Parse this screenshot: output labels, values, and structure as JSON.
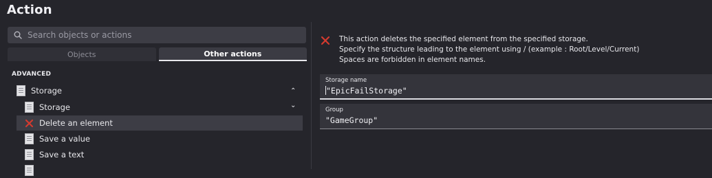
{
  "header": {
    "title": "Action"
  },
  "search": {
    "placeholder": "Search objects or actions",
    "value": ""
  },
  "tabs": [
    {
      "label": "Objects",
      "active": false
    },
    {
      "label": "Other actions",
      "active": true
    }
  ],
  "tree": {
    "section_label": "ADVANCED",
    "items": [
      {
        "label": "Storage",
        "icon": "storage-icon",
        "chevron": "up"
      },
      {
        "label": "Storage",
        "icon": "storage-icon",
        "chevron": "down"
      },
      {
        "label": "Delete an element",
        "icon": "delete-icon",
        "selected": true
      },
      {
        "label": "Save a value",
        "icon": "storage-icon"
      },
      {
        "label": "Save a text",
        "icon": "storage-icon"
      }
    ]
  },
  "description": {
    "icon": "delete-icon",
    "lines": [
      "This action deletes the specified element from the specified storage.",
      "Specify the structure leading to the element using / (example : Root/Level/Current)",
      "Spaces are forbidden in element names."
    ]
  },
  "fields": [
    {
      "label": "Storage name",
      "value": "\"EpicFailStorage\"",
      "focused": true
    },
    {
      "label": "Group",
      "value": "\"GameGroup\"",
      "focused": false
    }
  ],
  "colors": {
    "background": "#25252b",
    "delete_icon_red": "#d43a2f",
    "selected_row": "#3d3d45"
  }
}
